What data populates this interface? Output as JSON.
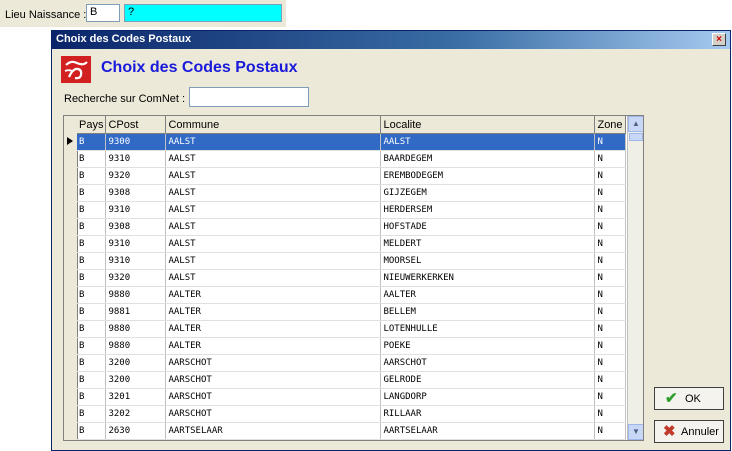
{
  "top": {
    "label": "Lieu Naissance :",
    "country_value": "B",
    "description_value": "?"
  },
  "dialog": {
    "title": "Choix des Codes Postaux",
    "close_symbol": "×",
    "heading": "Choix des Codes Postaux",
    "search_label": "Recherche sur ComNet :",
    "search_value": "",
    "ok_label": "OK",
    "cancel_label": "Annuler"
  },
  "grid": {
    "columns": [
      "Pays",
      "CPost",
      "Commune",
      "Localite",
      "Zone"
    ],
    "selected_row": 0,
    "rows": [
      [
        "B",
        "9300",
        "AALST",
        "AALST",
        "N"
      ],
      [
        "B",
        "9310",
        "AALST",
        "BAARDEGEM",
        "N"
      ],
      [
        "B",
        "9320",
        "AALST",
        "EREMBODEGEM",
        "N"
      ],
      [
        "B",
        "9308",
        "AALST",
        "GIJZEGEM",
        "N"
      ],
      [
        "B",
        "9310",
        "AALST",
        "HERDERSEM",
        "N"
      ],
      [
        "B",
        "9308",
        "AALST",
        "HOFSTADE",
        "N"
      ],
      [
        "B",
        "9310",
        "AALST",
        "MELDERT",
        "N"
      ],
      [
        "B",
        "9310",
        "AALST",
        "MOORSEL",
        "N"
      ],
      [
        "B",
        "9320",
        "AALST",
        "NIEUWERKERKEN",
        "N"
      ],
      [
        "B",
        "9880",
        "AALTER",
        "AALTER",
        "N"
      ],
      [
        "B",
        "9881",
        "AALTER",
        "BELLEM",
        "N"
      ],
      [
        "B",
        "9880",
        "AALTER",
        "LOTENHULLE",
        "N"
      ],
      [
        "B",
        "9880",
        "AALTER",
        "POEKE",
        "N"
      ],
      [
        "B",
        "3200",
        "AARSCHOT",
        "AARSCHOT",
        "N"
      ],
      [
        "B",
        "3200",
        "AARSCHOT",
        "GELRODE",
        "N"
      ],
      [
        "B",
        "3201",
        "AARSCHOT",
        "LANGDORP",
        "N"
      ],
      [
        "B",
        "3202",
        "AARSCHOT",
        "RILLAAR",
        "N"
      ],
      [
        "B",
        "2630",
        "AARTSELAAR",
        "AARTSELAAR",
        "N"
      ]
    ]
  },
  "colors": {
    "title_bar": "#0a246a",
    "heading": "#1a1adb",
    "selection": "#316ac5",
    "logo": "#d21f1f"
  },
  "icons": {
    "ok": "checkmark-icon",
    "cancel": "x-icon",
    "logo": "post-logo-icon"
  }
}
